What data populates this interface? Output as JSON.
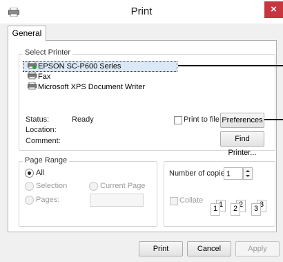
{
  "window": {
    "title": "Print",
    "close_glyph": "×"
  },
  "tabs": [
    {
      "label": "General"
    }
  ],
  "select_printer": {
    "title": "Select Printer",
    "printers": [
      {
        "name": "EPSON SC-P600 Series",
        "icon": "printer-default-icon"
      },
      {
        "name": "Fax",
        "icon": "fax-icon"
      },
      {
        "name": "Microsoft XPS Document Writer",
        "icon": "printer-icon"
      }
    ],
    "status_label": "Status:",
    "status_value": "Ready",
    "location_label": "Location:",
    "comment_label": "Comment:",
    "print_to_file_label": "Print to file",
    "preferences_label": "Preferences",
    "find_printer_label": "Find Printer..."
  },
  "page_range": {
    "title": "Page Range",
    "all_label": "All",
    "selection_label": "Selection",
    "current_page_label": "Current Page",
    "pages_label": "Pages:",
    "pages_value": ""
  },
  "copies": {
    "number_label": "Number of copies:",
    "value": "1",
    "collate_label": "Collate",
    "collate_pages": [
      "1",
      "1",
      "2",
      "2",
      "3",
      "3"
    ]
  },
  "buttons": {
    "print": "Print",
    "cancel": "Cancel",
    "apply": "Apply"
  }
}
